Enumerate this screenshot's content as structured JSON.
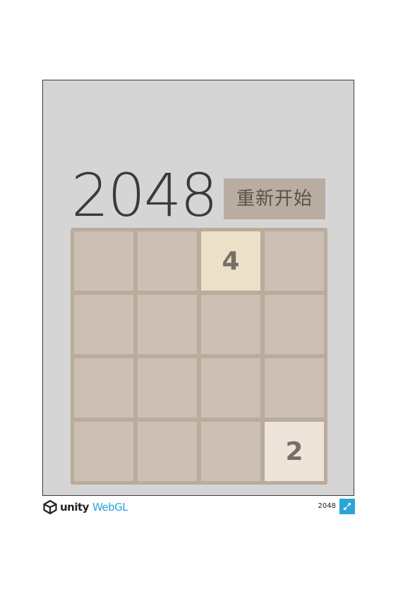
{
  "game": {
    "title": "2048",
    "restart_label": "重新开始",
    "grid": [
      [
        "",
        "",
        "4",
        ""
      ],
      [
        "",
        "",
        "",
        ""
      ],
      [
        "",
        "",
        "",
        ""
      ],
      [
        "",
        "",
        "",
        "2"
      ]
    ],
    "colors": {
      "canvas_bg": "#d5d5d5",
      "board_bg": "#baab9d",
      "empty_cell": "#cbc0b3",
      "tile_2": "#eee4da",
      "tile_4": "#ede0c8",
      "tile_text": "#776e65",
      "button_bg": "#b9aca0"
    }
  },
  "footer": {
    "unity_label": "unity",
    "webgl_label": "WebGL",
    "build_title": "2048",
    "fullscreen_icon": "fullscreen-icon",
    "accent": "#2aa5d6"
  }
}
